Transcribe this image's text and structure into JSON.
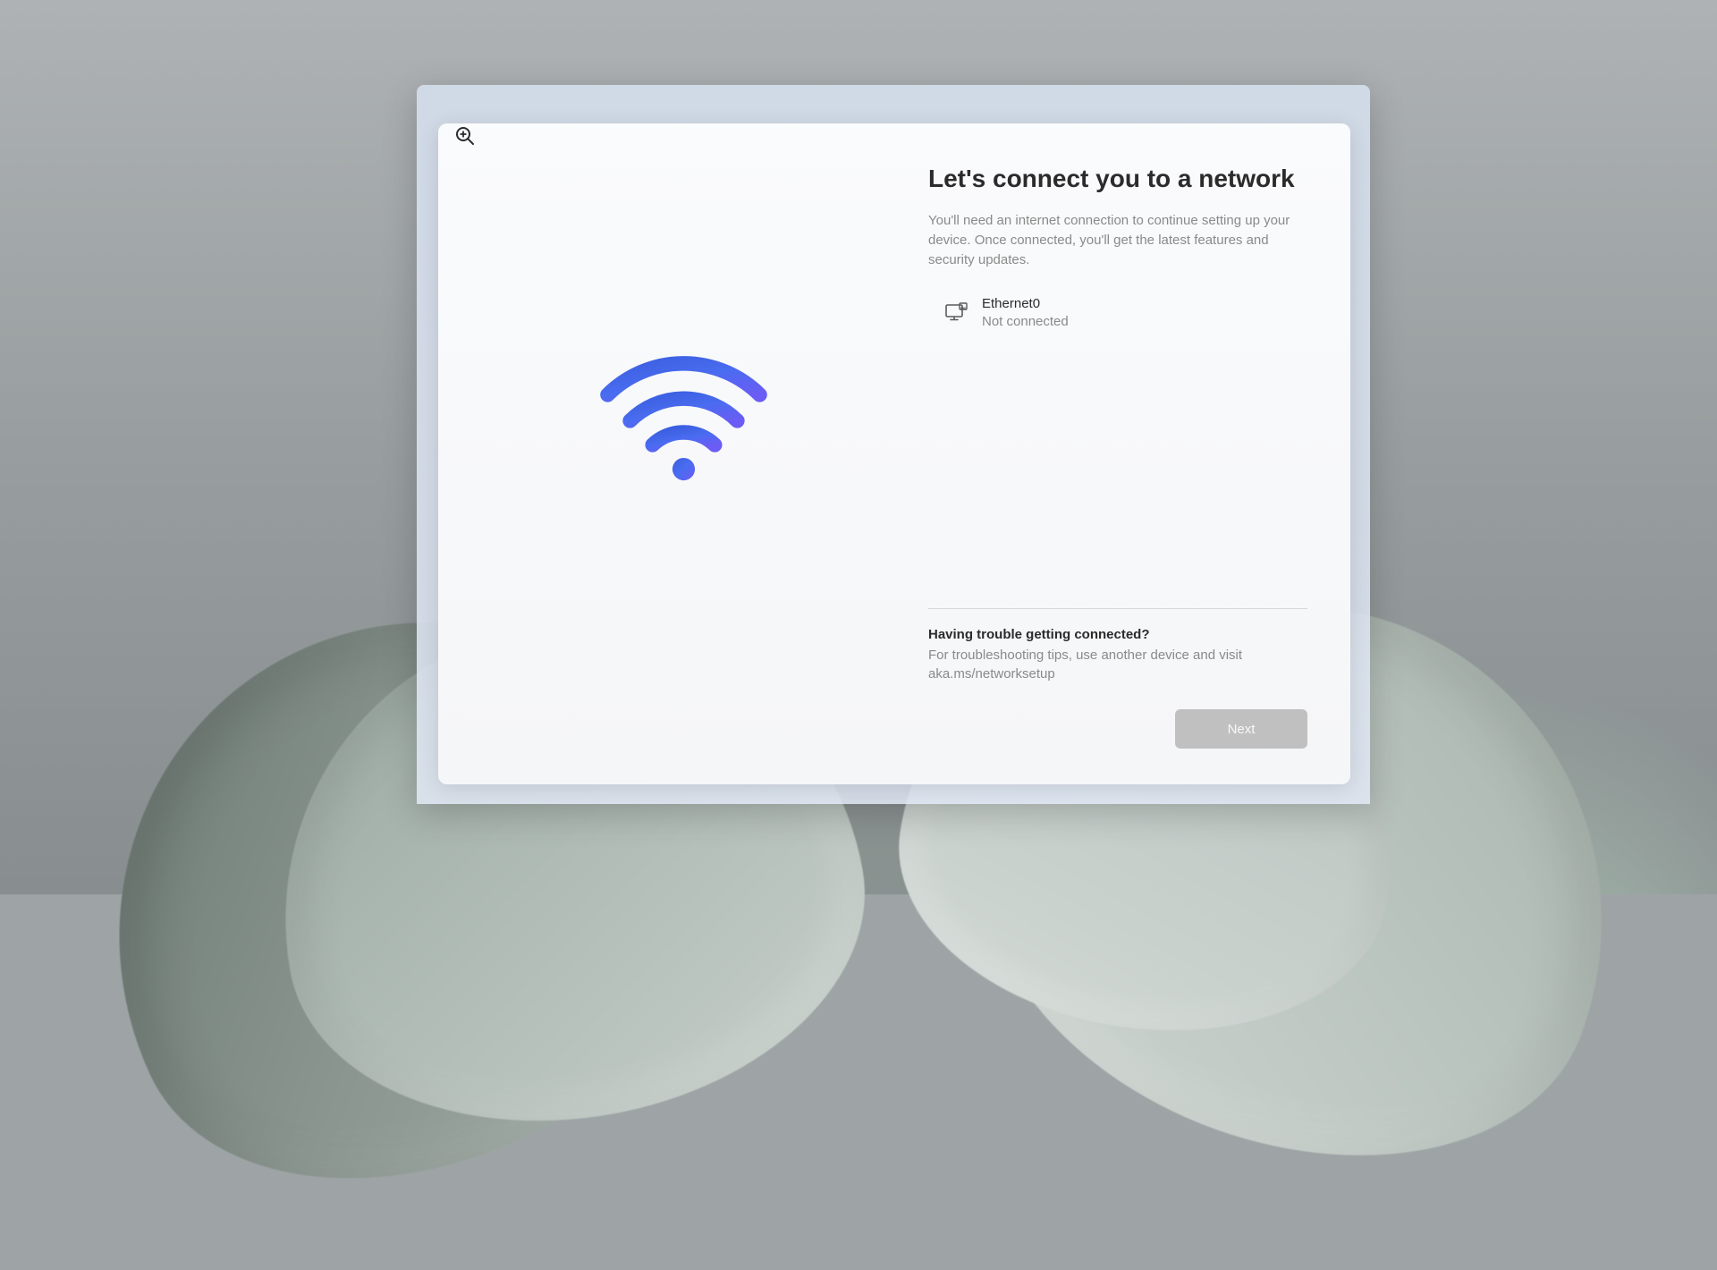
{
  "title": "Let's connect you to a network",
  "description": "You'll need an internet connection to continue setting up your device. Once connected, you'll get the latest features and security updates.",
  "network": {
    "name": "Ethernet0",
    "status": "Not connected"
  },
  "help": {
    "title": "Having trouble getting connected?",
    "text": "For troubleshooting tips, use another device and visit aka.ms/networksetup"
  },
  "buttons": {
    "next": "Next"
  }
}
